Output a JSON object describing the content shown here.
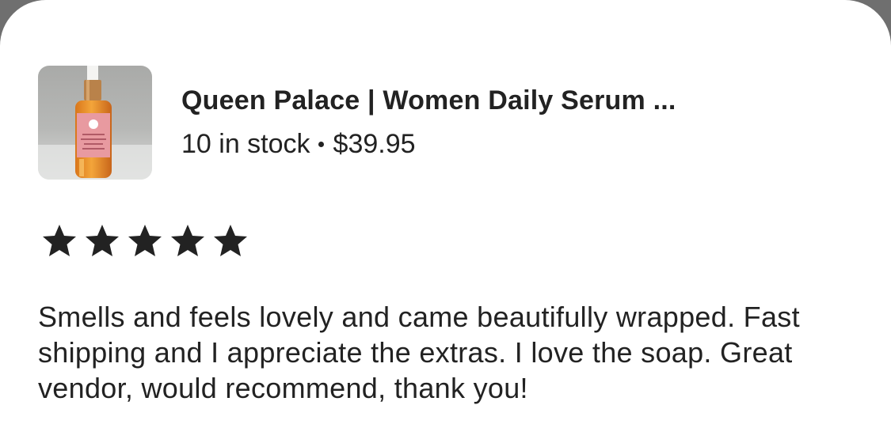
{
  "listing": {
    "title": "Queen Palace | Women Daily Serum ...",
    "stock": "10 in stock",
    "price": "$39.95"
  },
  "rating": {
    "value": 5,
    "max": 5
  },
  "review": {
    "text": "Smells and feels lovely and came beautifully wrapped. Fast shipping and I appreciate the extras. I love the soap. Great vendor, would recommend, thank you!"
  },
  "colors": {
    "text": "#222222",
    "card": "#ffffff",
    "backdrop": "#6f6f6f",
    "star": "#222222"
  },
  "icons": {
    "star": "star-filled-icon",
    "thumbnail": "serum-bottle-image"
  }
}
